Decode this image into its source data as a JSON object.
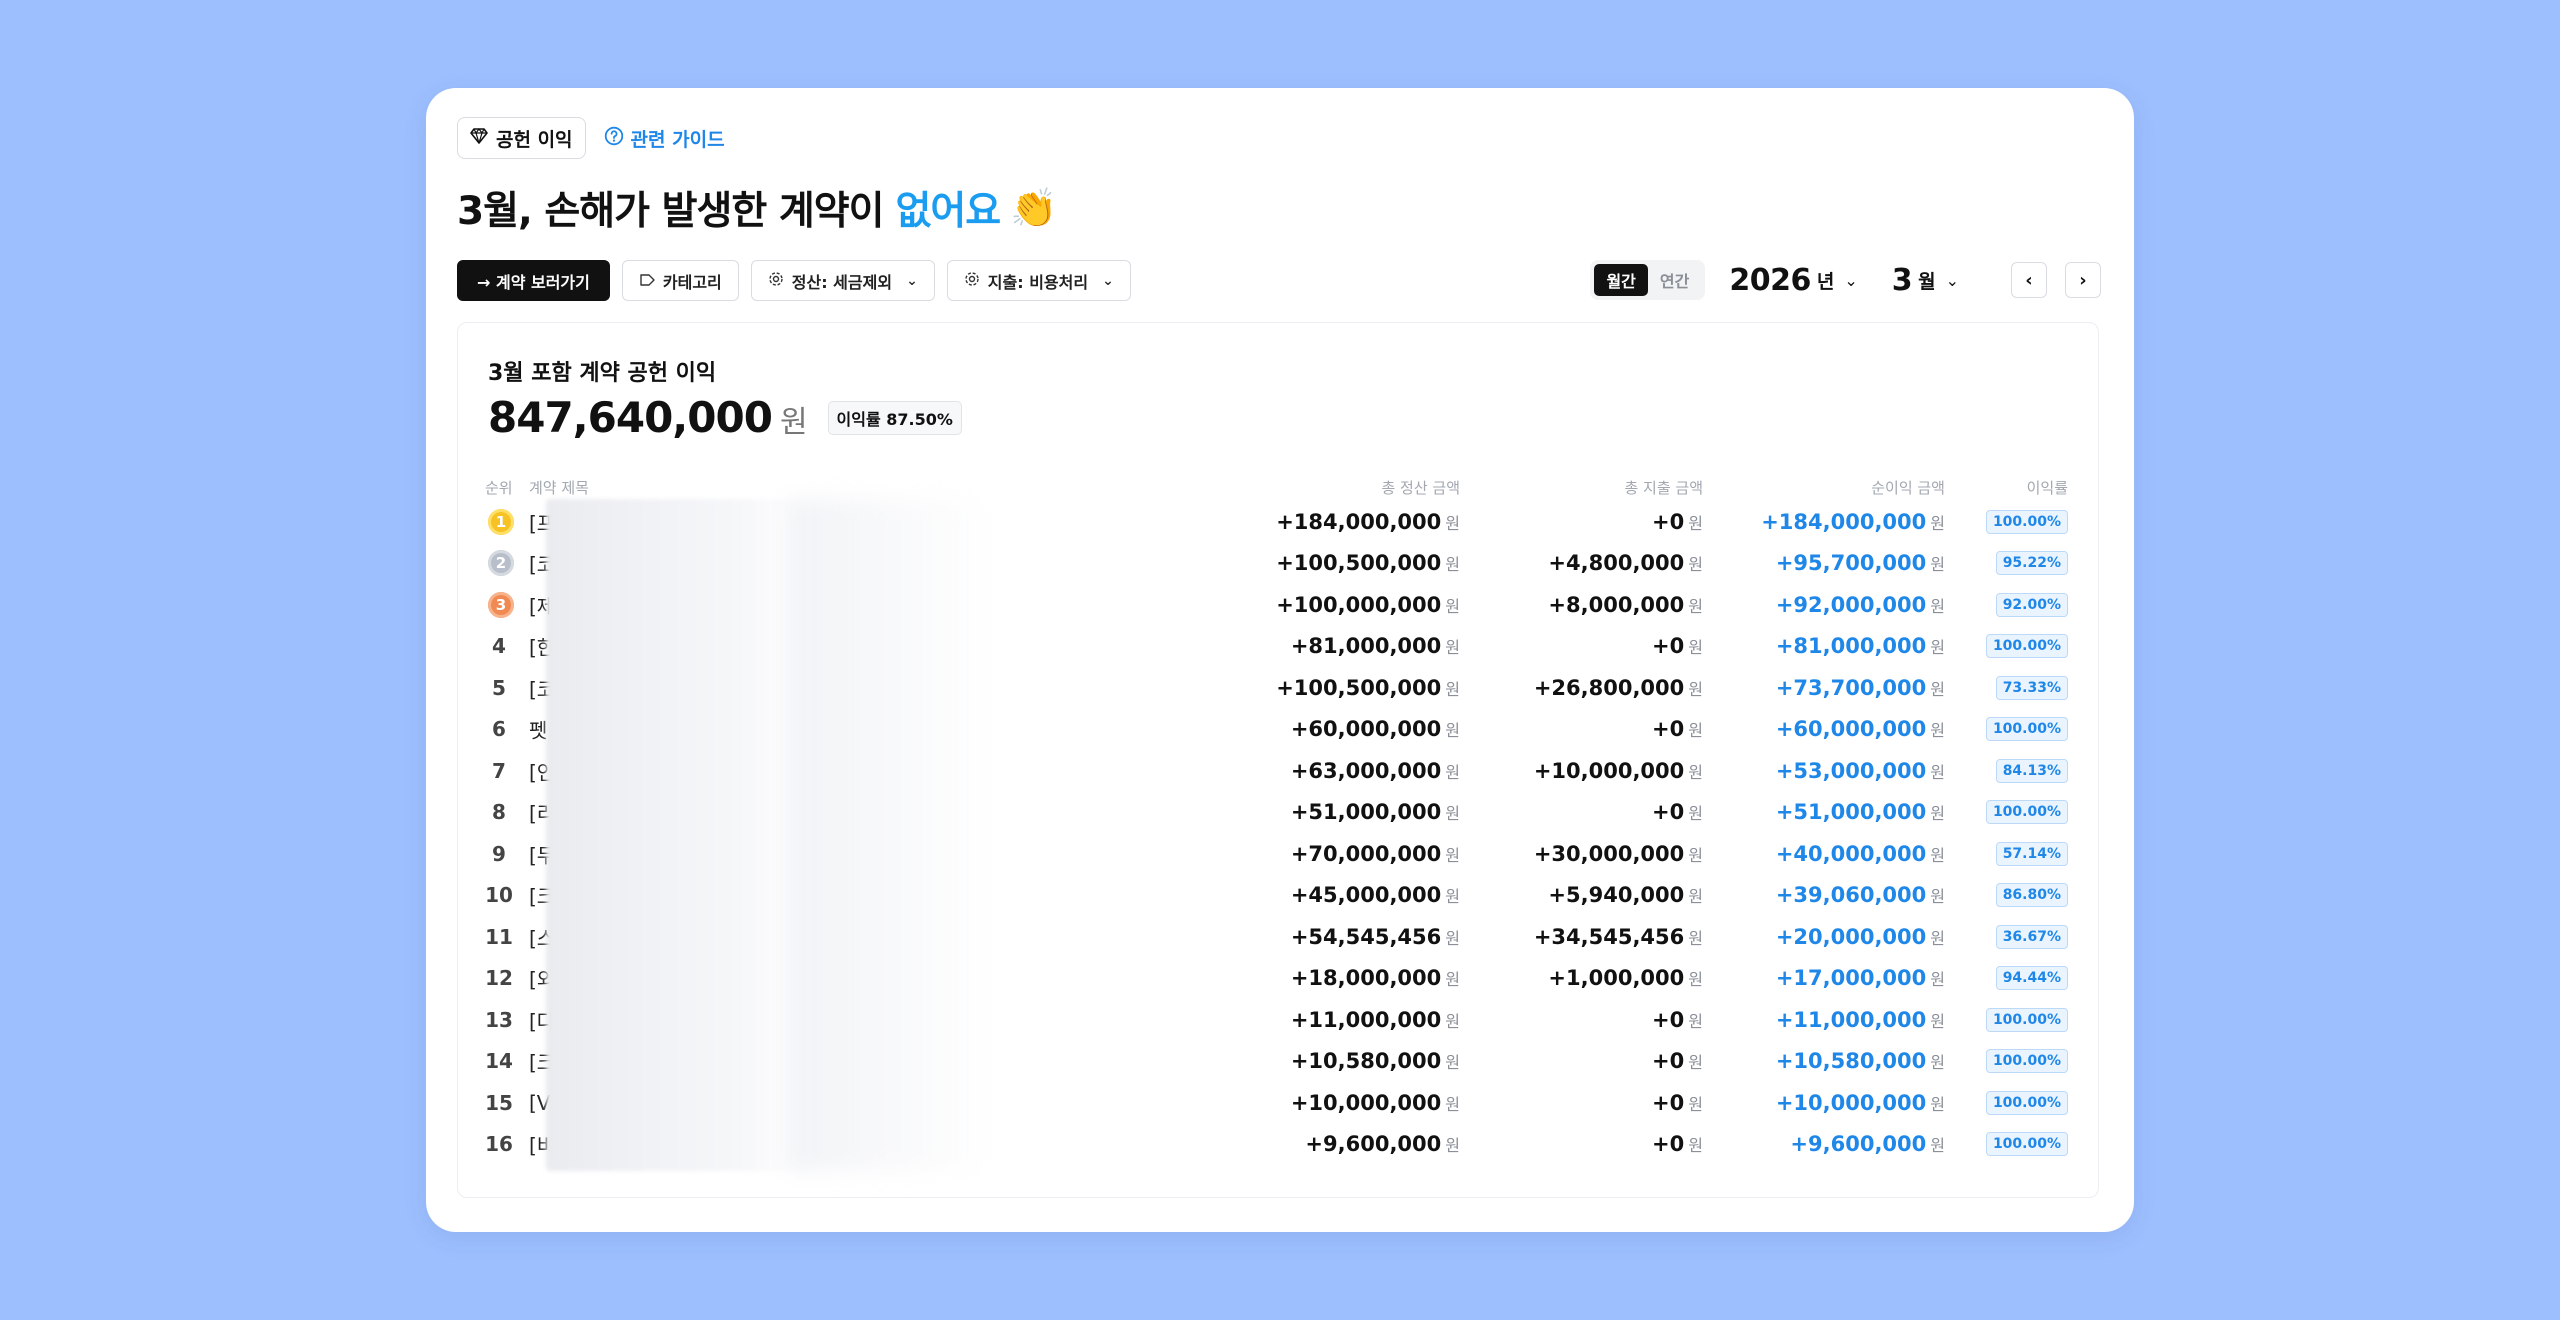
{
  "badge": {
    "label": "공헌 이익",
    "icon": "gem-icon"
  },
  "guide": {
    "label": "관련 가이드",
    "icon": "help-circle-icon"
  },
  "headline": {
    "prefix": "3월, 손해가 발생한 계약이",
    "highlight": "없어요",
    "emoji": "👏"
  },
  "toolbar": {
    "view_contracts": "→ 계약 보러가기",
    "category": "카테고리",
    "settlement": "정산: 세금제외",
    "expense": "지출: 비용처리"
  },
  "period": {
    "monthly": "월간",
    "yearly": "연간",
    "year": "2026",
    "year_unit": "년",
    "month": "3",
    "month_unit": "월"
  },
  "summary": {
    "title": "3월 포함 계약 공헌 이익",
    "total": "847,640,000",
    "currency": "원",
    "rate": "이익률 87.50%"
  },
  "table": {
    "headers": {
      "rank": "순위",
      "title": "계약 제목",
      "settlement": "총 정산 금액",
      "expense": "총 지출 금액",
      "net": "순이익 금액",
      "margin": "이익률"
    },
    "currency": "원",
    "rows": [
      {
        "rank": "1",
        "title": "[프",
        "settlement": "+184,000,000",
        "expense": "+0",
        "net": "+184,000,000",
        "margin": "100.00%"
      },
      {
        "rank": "2",
        "title": "[코",
        "settlement": "+100,500,000",
        "expense": "+4,800,000",
        "net": "+95,700,000",
        "margin": "95.22%"
      },
      {
        "rank": "3",
        "title": "[제",
        "settlement": "+100,000,000",
        "expense": "+8,000,000",
        "net": "+92,000,000",
        "margin": "92.00%"
      },
      {
        "rank": "4",
        "title": "[한",
        "settlement": "+81,000,000",
        "expense": "+0",
        "net": "+81,000,000",
        "margin": "100.00%"
      },
      {
        "rank": "5",
        "title": "[코",
        "settlement": "+100,500,000",
        "expense": "+26,800,000",
        "net": "+73,700,000",
        "margin": "73.33%"
      },
      {
        "rank": "6",
        "title": "펫",
        "settlement": "+60,000,000",
        "expense": "+0",
        "net": "+60,000,000",
        "margin": "100.00%"
      },
      {
        "rank": "7",
        "title": "[인",
        "settlement": "+63,000,000",
        "expense": "+10,000,000",
        "net": "+53,000,000",
        "margin": "84.13%"
      },
      {
        "rank": "8",
        "title": "[리",
        "settlement": "+51,000,000",
        "expense": "+0",
        "net": "+51,000,000",
        "margin": "100.00%"
      },
      {
        "rank": "9",
        "title": "[두",
        "settlement": "+70,000,000",
        "expense": "+30,000,000",
        "net": "+40,000,000",
        "margin": "57.14%"
      },
      {
        "rank": "10",
        "title": "[크",
        "settlement": "+45,000,000",
        "expense": "+5,940,000",
        "net": "+39,060,000",
        "margin": "86.80%"
      },
      {
        "rank": "11",
        "title": "[스",
        "settlement": "+54,545,456",
        "expense": "+34,545,456",
        "net": "+20,000,000",
        "margin": "36.67%"
      },
      {
        "rank": "12",
        "title": "[외",
        "settlement": "+18,000,000",
        "expense": "+1,000,000",
        "net": "+17,000,000",
        "margin": "94.44%"
      },
      {
        "rank": "13",
        "title": "[다",
        "settlement": "+11,000,000",
        "expense": "+0",
        "net": "+11,000,000",
        "margin": "100.00%"
      },
      {
        "rank": "14",
        "title": "[크",
        "settlement": "+10,580,000",
        "expense": "+0",
        "net": "+10,580,000",
        "margin": "100.00%"
      },
      {
        "rank": "15",
        "title": "[V",
        "settlement": "+10,000,000",
        "expense": "+0",
        "net": "+10,000,000",
        "margin": "100.00%"
      },
      {
        "rank": "16",
        "title": "[비",
        "settlement": "+9,600,000",
        "expense": "+0",
        "net": "+9,600,000",
        "margin": "100.00%"
      }
    ]
  },
  "colors": {
    "background": "#9dbffe",
    "accent": "#1f87e8",
    "headline_highlight": "#1a9cf0",
    "gold": "#f7c324",
    "silver": "#b8bfca",
    "bronze": "#f08a52"
  }
}
